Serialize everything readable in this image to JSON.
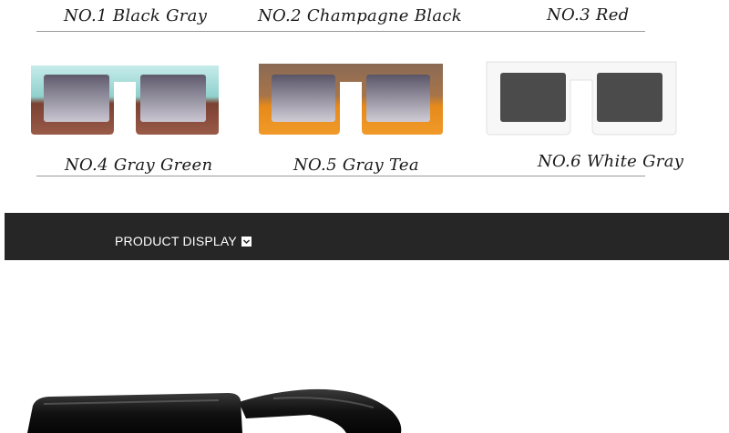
{
  "variants_top": [
    {
      "label": "NO.1 Black Gray"
    },
    {
      "label": "NO.2 Champagne Black"
    },
    {
      "label": "NO.3 Red"
    }
  ],
  "variants_bottom": [
    {
      "label": "NO.4 Gray Green",
      "frame_colors": [
        "#bfe3e3",
        "#8b4a3a"
      ],
      "lens_color": "#6e6a7a"
    },
    {
      "label": "NO.5 Gray Tea",
      "frame_colors": [
        "#8a6a55",
        "#e68a1a"
      ],
      "lens_color": "#6a6676"
    },
    {
      "label": "NO.6 White Gray",
      "frame_colors": [
        "#f5f5f5",
        "#e8e8e8"
      ],
      "lens_color": "#4a4a4a"
    }
  ],
  "banner": {
    "title": "PRODUCT DISPLAY",
    "background": "#262626",
    "icon": "chevron-down-icon"
  }
}
